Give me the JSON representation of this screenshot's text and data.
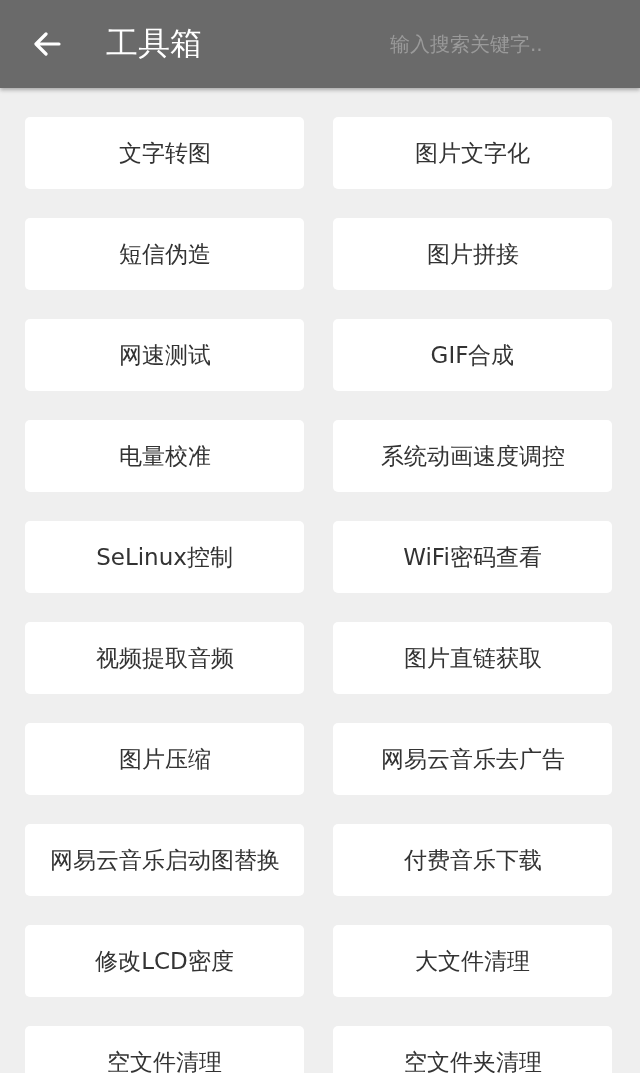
{
  "header": {
    "title": "工具箱",
    "search": {
      "placeholder": "输入搜索关键字.."
    }
  },
  "tools": [
    {
      "label": "文字转图"
    },
    {
      "label": "图片文字化"
    },
    {
      "label": "短信伪造"
    },
    {
      "label": "图片拼接"
    },
    {
      "label": "网速测试"
    },
    {
      "label": "GIF合成"
    },
    {
      "label": "电量校准"
    },
    {
      "label": "系统动画速度调控"
    },
    {
      "label": "SeLinux控制"
    },
    {
      "label": "WiFi密码查看"
    },
    {
      "label": "视频提取音频"
    },
    {
      "label": "图片直链获取"
    },
    {
      "label": "图片压缩"
    },
    {
      "label": "网易云音乐去广告"
    },
    {
      "label": "网易云音乐启动图替换"
    },
    {
      "label": "付费音乐下载"
    },
    {
      "label": "修改LCD密度"
    },
    {
      "label": "大文件清理"
    },
    {
      "label": "空文件清理"
    },
    {
      "label": "空文件夹清理"
    }
  ]
}
